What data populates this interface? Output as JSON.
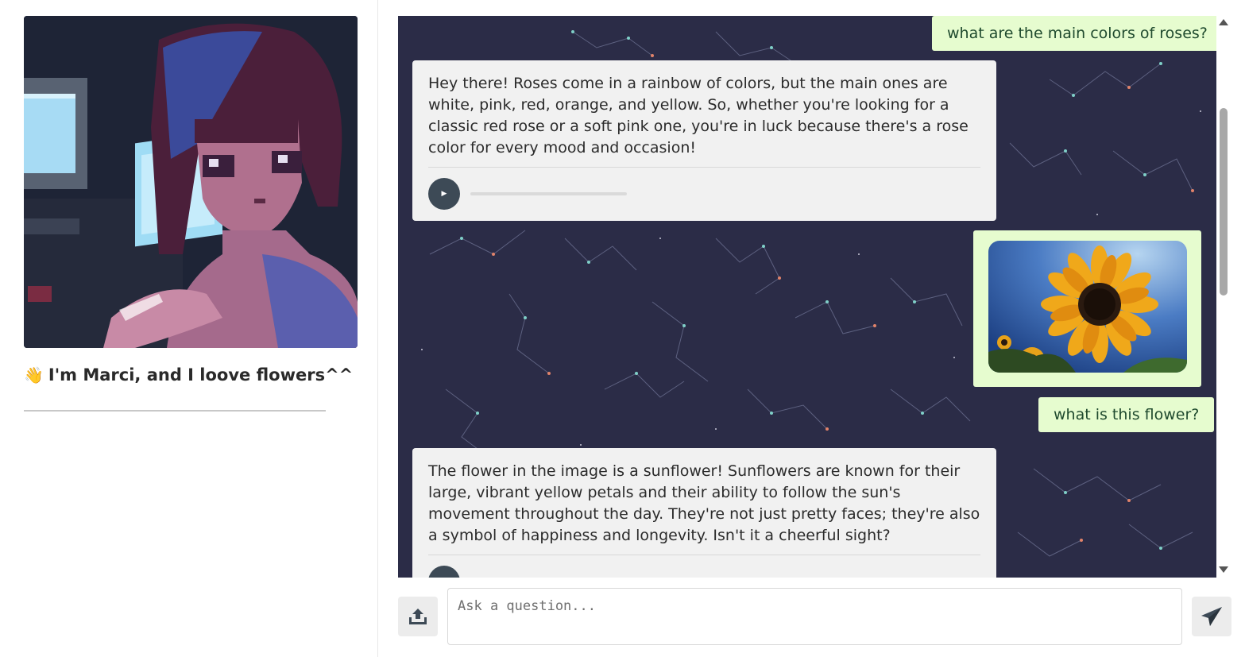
{
  "profile": {
    "avatar_icon": "pixel-art-girl-avatar",
    "greeting_emoji": "👋",
    "greeting_text": "I'm Marci, and I loove flowers^^"
  },
  "chat": {
    "background_color": "#2b2c47",
    "messages": [
      {
        "role": "user",
        "type": "text",
        "text": "what are the main colors of roses?"
      },
      {
        "role": "assistant",
        "type": "text",
        "text": "Hey there! Roses come in a rainbow of colors, but the main ones are white, pink, red, orange, and yellow. So, whether you're looking for a classic red rose or a soft pink one, you're in luck because there's a rose color for every mood and occasion!",
        "audio_icon": "play-icon"
      },
      {
        "role": "user",
        "type": "image",
        "image_icon": "sunflower-photo"
      },
      {
        "role": "user",
        "type": "text",
        "text": "what is this flower?"
      },
      {
        "role": "assistant",
        "type": "text",
        "text": "The flower in the image is a sunflower! Sunflowers are known for their large, vibrant yellow petals and their ability to follow the sun's movement throughout the day. They're not just pretty faces; they're also a symbol of happiness and longevity. Isn't it a cheerful sight?",
        "audio_icon": "play-icon"
      }
    ]
  },
  "input": {
    "placeholder": "Ask a question...",
    "value": "",
    "upload_icon": "upload-icon",
    "send_icon": "send-icon"
  },
  "colors": {
    "user_bubble": "#e6fccf",
    "assistant_bubble": "#f1f1f1",
    "button_bg": "#ececec"
  }
}
